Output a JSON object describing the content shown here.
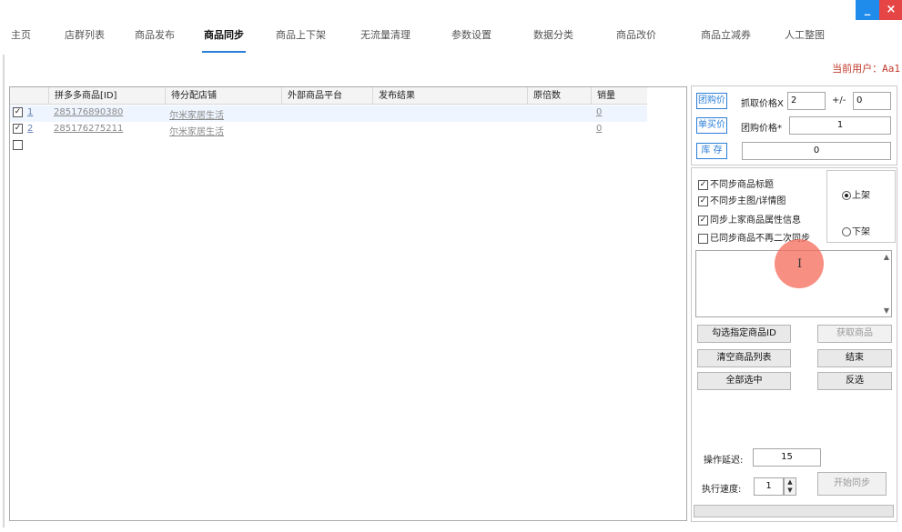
{
  "window": {
    "minimize_label": "_",
    "close_label": "×",
    "accent": "#1f8ceb",
    "close_color": "#e64545"
  },
  "tabs": [
    {
      "label": "主页"
    },
    {
      "label": "店群列表"
    },
    {
      "label": "商品发布"
    },
    {
      "label": "商品同步",
      "active": true
    },
    {
      "label": "商品上下架"
    },
    {
      "label": "无流量清理"
    },
    {
      "label": "参数设置"
    },
    {
      "label": "数据分类"
    },
    {
      "label": "商品改价"
    },
    {
      "label": "商品立减券"
    },
    {
      "label": "人工整图"
    }
  ],
  "current_user": {
    "label": "当前用户：",
    "value": "Aa1"
  },
  "grid": {
    "columns": [
      "拼多多商品[ID]",
      "待分配店铺",
      "外部商品平台",
      "发布结果",
      "原倍数",
      "销量"
    ],
    "rows": [
      {
        "checked": true,
        "index": "1",
        "product_id": "285176890380",
        "shop": "尔米家居生活",
        "platform": "",
        "result": "",
        "multiple": "",
        "sales": "0"
      },
      {
        "checked": true,
        "index": "2",
        "product_id": "285176275211",
        "shop": "尔米家居生活",
        "platform": "",
        "result": "",
        "multiple": "",
        "sales": "0"
      },
      {
        "checked": false,
        "index": "",
        "product_id": "",
        "shop": "",
        "platform": "",
        "result": "",
        "multiple": "",
        "sales": ""
      }
    ]
  },
  "price_panel": {
    "group_price_tag": "团购价",
    "single_price_tag": "单买价",
    "stock_tag": "库  存",
    "fetch_price_label": "抓取价格X",
    "fetch_price_value": "2",
    "plus_minus_label": "+/-",
    "plus_minus_value": "0",
    "group_price_label": "团购价格*",
    "group_price_value": "1",
    "stock_value": "0"
  },
  "sync_options": {
    "no_sync_title": {
      "label": "不同步商品标题",
      "checked": true
    },
    "no_sync_images": {
      "label": "不同步主图/详情图",
      "checked": true
    },
    "sync_attrs": {
      "label": "同步上家商品属性信息",
      "checked": true
    },
    "no_resync": {
      "label": "已同步商品不再二次同步",
      "checked": false
    },
    "shelf_on": {
      "label": "上架",
      "selected": true
    },
    "shelf_off": {
      "label": "下架",
      "selected": false
    }
  },
  "buttons": {
    "select_specified": "勾选指定商品ID",
    "get_products": "获取商品",
    "clear_list": "清空商品列表",
    "end": "结束",
    "select_all": "全部选中",
    "invert": "反选",
    "start_sync": "开始同步"
  },
  "settings": {
    "delay_label": "操作延迟:",
    "delay_value": "15",
    "speed_label": "执行速度:",
    "speed_value": "1"
  }
}
